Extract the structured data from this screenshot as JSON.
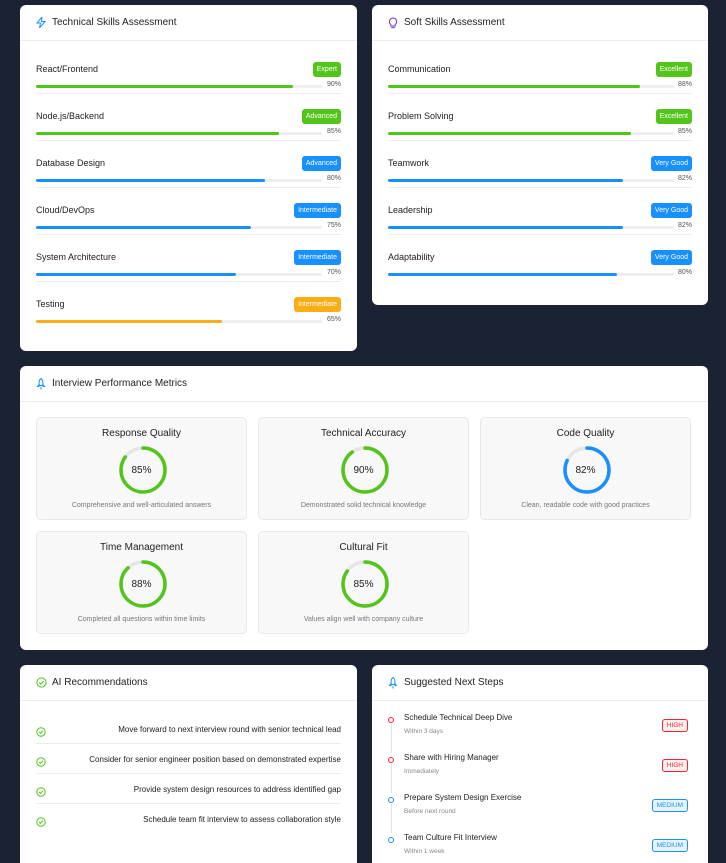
{
  "colors": {
    "background": "#1b2233",
    "green": "#52c41a",
    "blue": "#1890ff",
    "orange": "#faad14",
    "red": "#f5222d"
  },
  "technical": {
    "title": "Technical Skills Assessment",
    "icon": "lightning-icon",
    "skills": [
      {
        "name": "React/Frontend",
        "level": "Expert",
        "percent": 90,
        "percent_label": "90%",
        "color": "#52c41a"
      },
      {
        "name": "Node.js/Backend",
        "level": "Advanced",
        "percent": 85,
        "percent_label": "85%",
        "color": "#52c41a"
      },
      {
        "name": "Database Design",
        "level": "Advanced",
        "percent": 80,
        "percent_label": "80%",
        "color": "#1890ff"
      },
      {
        "name": "Cloud/DevOps",
        "level": "Intermediate",
        "percent": 75,
        "percent_label": "75%",
        "color": "#1890ff"
      },
      {
        "name": "System Architecture",
        "level": "Intermediate",
        "percent": 70,
        "percent_label": "70%",
        "color": "#1890ff"
      },
      {
        "name": "Testing",
        "level": "Intermediate",
        "percent": 65,
        "percent_label": "65%",
        "color": "#faad14"
      }
    ]
  },
  "soft": {
    "title": "Soft Skills Assessment",
    "icon": "bulb-icon",
    "skills": [
      {
        "name": "Communication",
        "level": "Excellent",
        "percent": 88,
        "percent_label": "88%",
        "color": "#52c41a"
      },
      {
        "name": "Problem Solving",
        "level": "Excellent",
        "percent": 85,
        "percent_label": "85%",
        "color": "#52c41a"
      },
      {
        "name": "Teamwork",
        "level": "Very Good",
        "percent": 82,
        "percent_label": "82%",
        "color": "#1890ff"
      },
      {
        "name": "Leadership",
        "level": "Very Good",
        "percent": 82,
        "percent_label": "82%",
        "color": "#1890ff"
      },
      {
        "name": "Adaptability",
        "level": "Very Good",
        "percent": 80,
        "percent_label": "80%",
        "color": "#1890ff"
      }
    ]
  },
  "performance": {
    "title": "Interview Performance Metrics",
    "icon": "rocket-icon",
    "metrics": [
      {
        "title": "Response Quality",
        "value": 85,
        "label": "85%",
        "desc": "Comprehensive and well-articulated answers",
        "color": "#52c41a"
      },
      {
        "title": "Technical Accuracy",
        "value": 90,
        "label": "90%",
        "desc": "Demonstrated solid technical knowledge",
        "color": "#52c41a"
      },
      {
        "title": "Code Quality",
        "value": 82,
        "label": "82%",
        "desc": "Clean, readable code with good practices",
        "color": "#1890ff"
      },
      {
        "title": "Time Management",
        "value": 88,
        "label": "88%",
        "desc": "Completed all questions within time limits",
        "color": "#52c41a"
      },
      {
        "title": "Cultural Fit",
        "value": 85,
        "label": "85%",
        "desc": "Values align well with company culture",
        "color": "#52c41a"
      }
    ]
  },
  "recommendations": {
    "title": "AI Recommendations",
    "icon": "check-circle-icon",
    "items": [
      "Move forward to next interview round with senior technical lead",
      "Consider for senior engineer position based on demonstrated expertise",
      "Provide system design resources to address identified gap",
      "Schedule team fit interview to assess collaboration style"
    ]
  },
  "next_steps": {
    "title": "Suggested Next Steps",
    "icon": "rocket-icon",
    "steps": [
      {
        "title": "Schedule Technical Deep Dive",
        "when": "Within 3 days",
        "priority": "HIGH",
        "color": "#f5222d"
      },
      {
        "title": "Share with Hiring Manager",
        "when": "Immediately",
        "priority": "HIGH",
        "color": "#f5222d"
      },
      {
        "title": "Prepare System Design Exercise",
        "when": "Before next round",
        "priority": "MEDIUM",
        "color": "#1890ff"
      },
      {
        "title": "Team Culture Fit Interview",
        "when": "Within 1 week",
        "priority": "MEDIUM",
        "color": "#1890ff"
      }
    ]
  }
}
